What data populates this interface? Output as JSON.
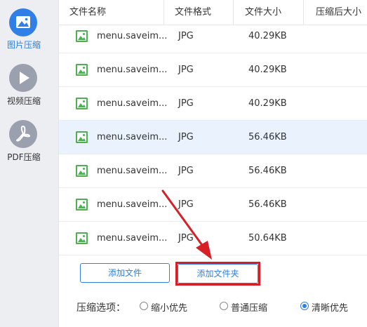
{
  "sidebar": {
    "items": [
      {
        "label": "图片压缩",
        "icon": "image-icon",
        "active": true
      },
      {
        "label": "视频压缩",
        "icon": "play-icon",
        "active": false
      },
      {
        "label": "PDF压缩",
        "icon": "pdf-icon",
        "active": false
      }
    ]
  },
  "table": {
    "headers": [
      "文件名称",
      "文件格式",
      "文件大小",
      "压缩后大小"
    ],
    "rows": [
      {
        "name": "menu.saveim...",
        "format": "JPG",
        "size": "40.29KB",
        "compressed": ""
      },
      {
        "name": "menu.saveim...",
        "format": "JPG",
        "size": "40.29KB",
        "compressed": ""
      },
      {
        "name": "menu.saveim...",
        "format": "JPG",
        "size": "40.29KB",
        "compressed": ""
      },
      {
        "name": "menu.saveim...",
        "format": "JPG",
        "size": "56.46KB",
        "compressed": "",
        "selected": true
      },
      {
        "name": "menu.saveim...",
        "format": "JPG",
        "size": "56.46KB",
        "compressed": ""
      },
      {
        "name": "menu.saveim...",
        "format": "JPG",
        "size": "56.46KB",
        "compressed": ""
      },
      {
        "name": "menu.saveim...",
        "format": "JPG",
        "size": "50.64KB",
        "compressed": ""
      }
    ]
  },
  "actions": {
    "add_file": "添加文件",
    "add_folder": "添加文件夹"
  },
  "options": {
    "label": "压缩选项：",
    "choices": [
      {
        "label": "缩小优先",
        "checked": false
      },
      {
        "label": "普通压缩",
        "checked": false
      },
      {
        "label": "清晰优先",
        "checked": true
      }
    ]
  },
  "colors": {
    "accent": "#2f7fe6",
    "file_icon": "#4caf50",
    "annotation": "#d71f26",
    "selected_row": "#eaf3fd"
  }
}
